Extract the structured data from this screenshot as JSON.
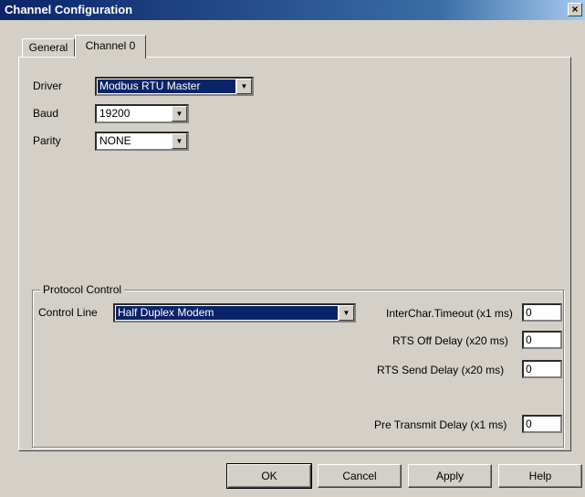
{
  "window": {
    "title": "Channel Configuration",
    "close_glyph": "×"
  },
  "tabs": [
    {
      "label": "General",
      "active": false
    },
    {
      "label": "Channel 0",
      "active": true
    }
  ],
  "driver": {
    "label": "Driver",
    "value": "Modbus RTU Master"
  },
  "baud": {
    "label": "Baud",
    "value": "19200"
  },
  "parity": {
    "label": "Parity",
    "value": "NONE"
  },
  "protocol_control": {
    "legend": "Protocol Control",
    "control_line": {
      "label": "Control Line",
      "value": "Half Duplex Modem"
    },
    "interchar_timeout": {
      "label": "InterChar.Timeout (x1 ms)",
      "value": "0"
    },
    "rts_off_delay": {
      "label": "RTS Off Delay (x20 ms)",
      "value": "0"
    },
    "rts_send_delay": {
      "label": "RTS Send Delay (x20 ms)",
      "value": "0"
    },
    "pre_transmit_delay": {
      "label": "Pre Transmit Delay (x1 ms)",
      "value": "0"
    }
  },
  "buttons": {
    "ok": "OK",
    "cancel": "Cancel",
    "apply": "Apply",
    "help": "Help"
  },
  "icons": {
    "dropdown_arrow": "▼"
  }
}
